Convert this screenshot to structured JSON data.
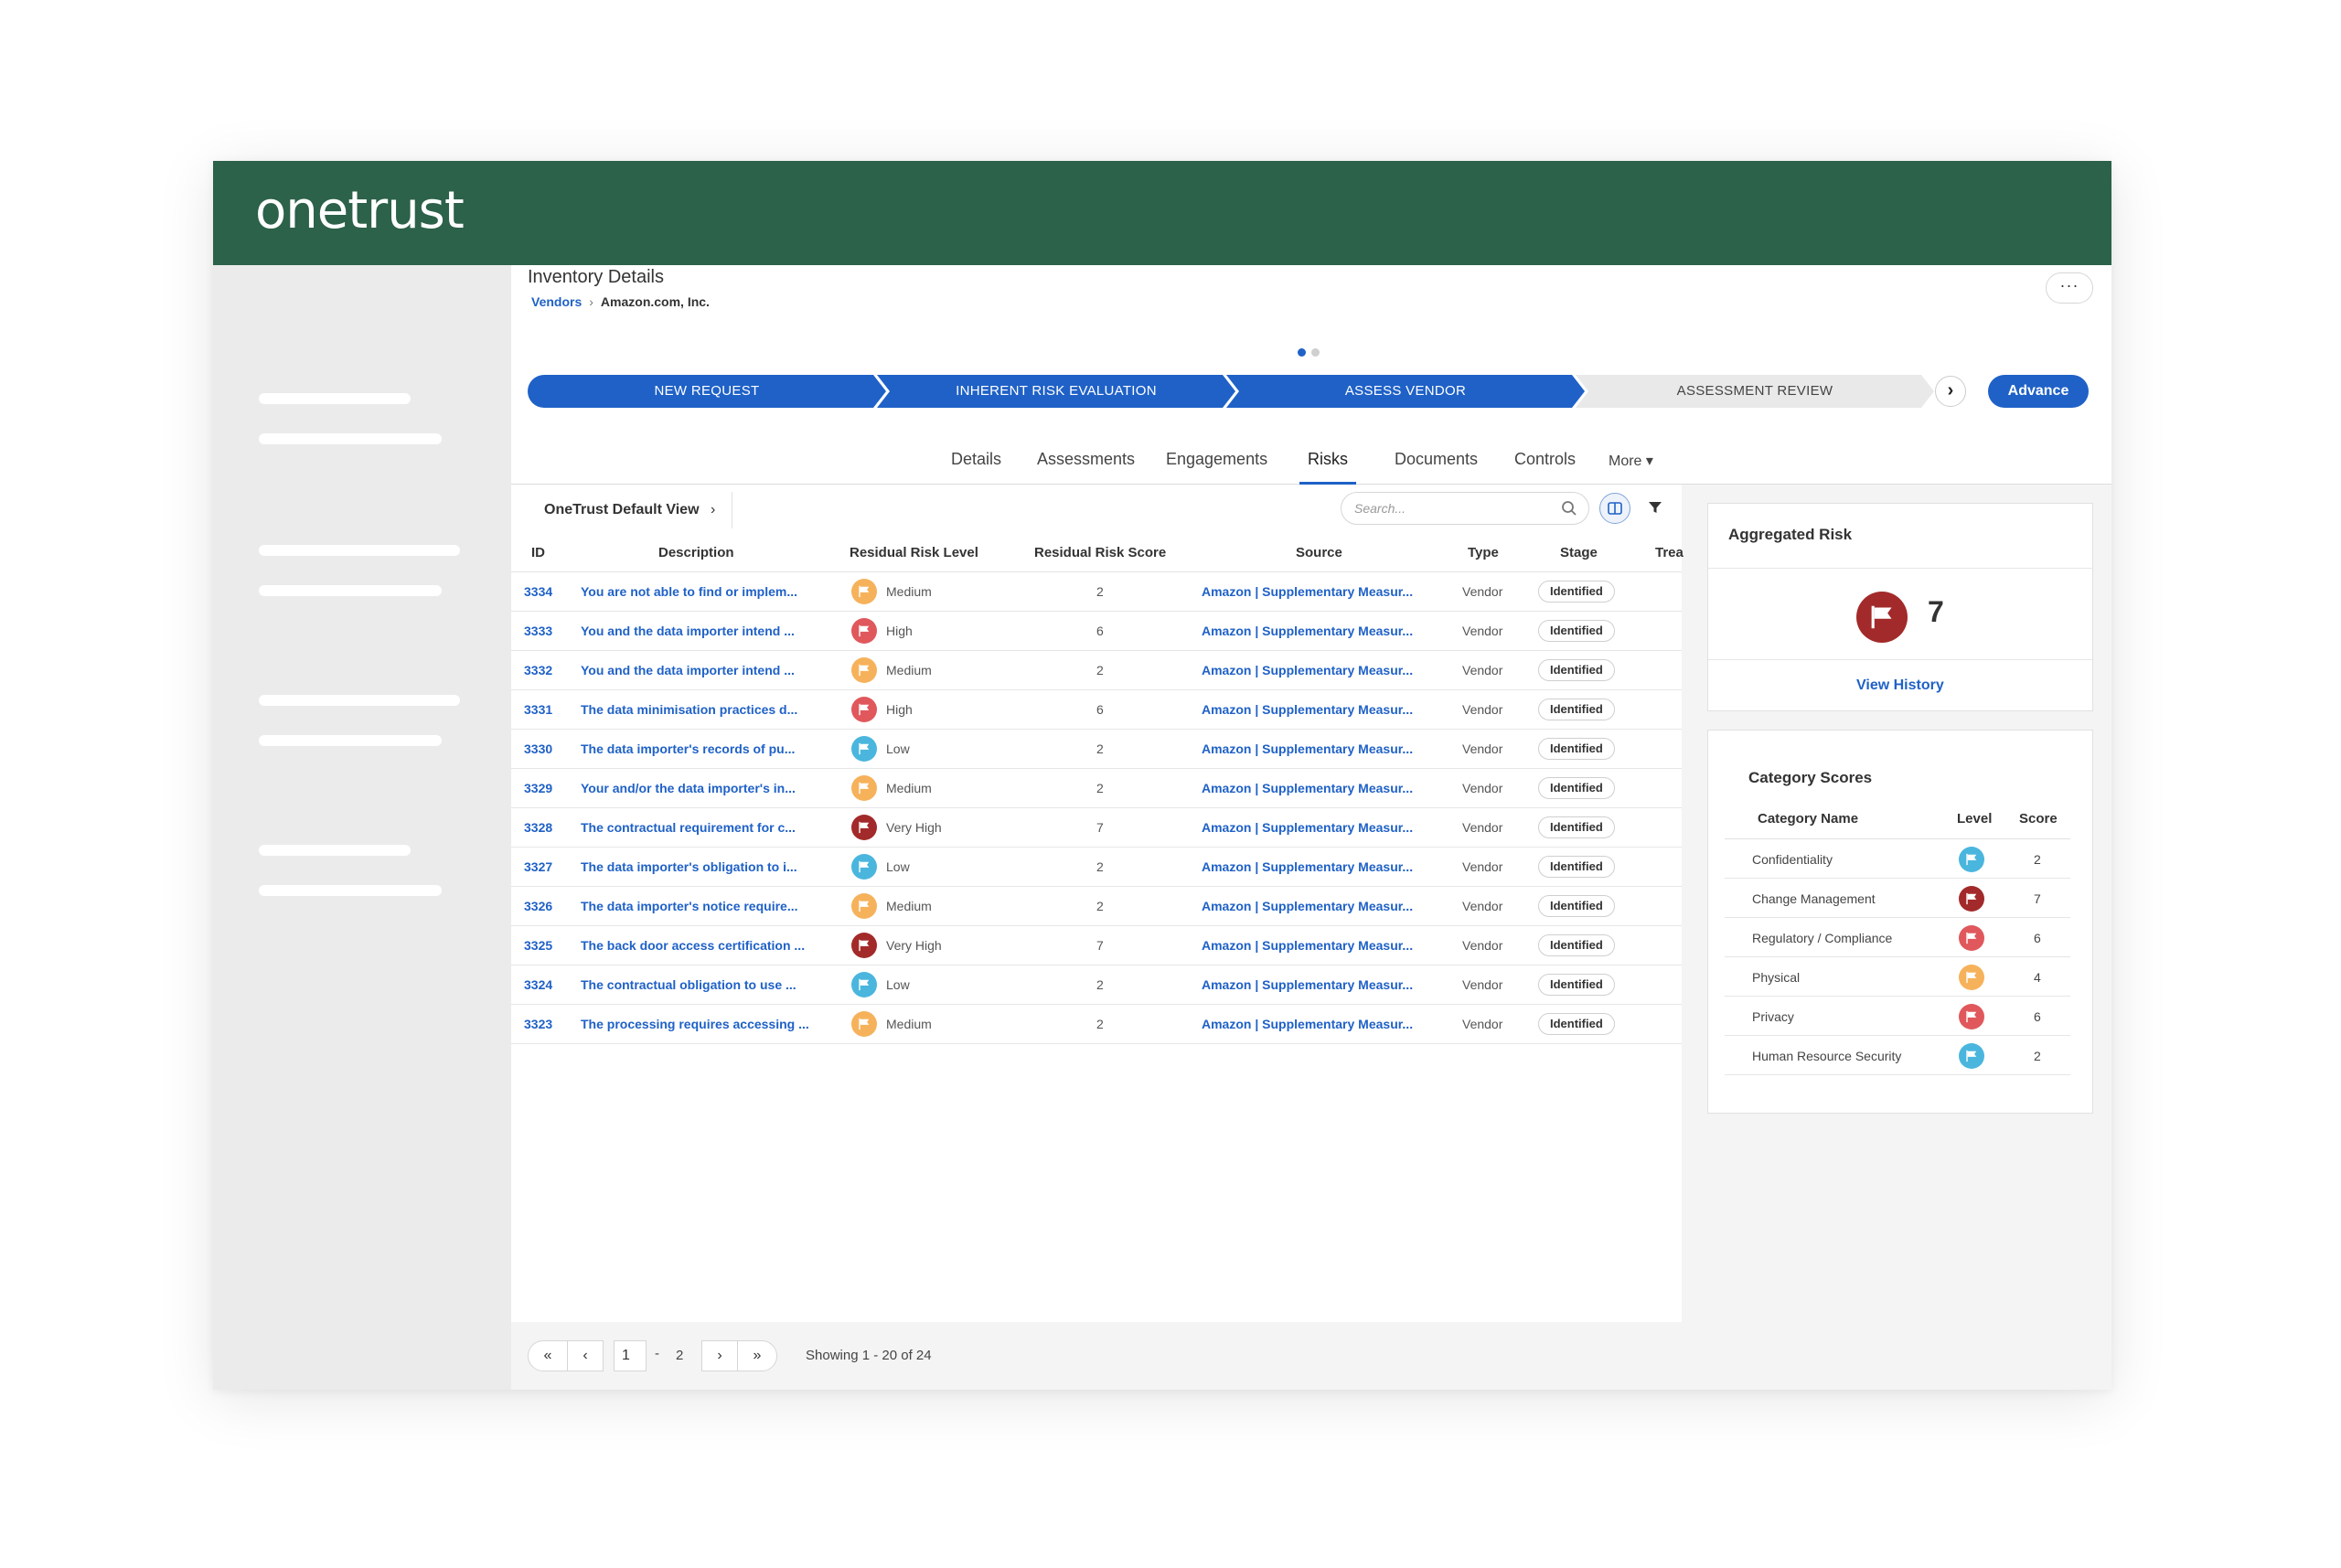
{
  "app": {
    "logo_text": "onetrust"
  },
  "header": {
    "title": "Inventory Details",
    "breadcrumb": {
      "parent": "Vendors",
      "current": "Amazon.com, Inc."
    },
    "more_label": "···"
  },
  "stepper": {
    "steps": [
      {
        "label": "NEW REQUEST",
        "status": "done"
      },
      {
        "label": "INHERENT RISK EVALUATION",
        "status": "done"
      },
      {
        "label": "ASSESS VENDOR",
        "status": "current"
      },
      {
        "label": "ASSESSMENT REVIEW",
        "status": "todo"
      }
    ],
    "next_icon": "chevron-right-icon",
    "advance_label": "Advance"
  },
  "tabs": {
    "items": [
      "Details",
      "Assessments",
      "Engagements",
      "Risks",
      "Documents",
      "Controls",
      "More ▾"
    ],
    "active": "Risks"
  },
  "toolbar": {
    "view_label": "OneTrust Default View",
    "view_chevron": "›",
    "search_placeholder": "Search..."
  },
  "colors": {
    "brand_green": "#2c614a",
    "accent_blue": "#1f61c7",
    "low": "#4ab6de",
    "medium": "#f6b25b",
    "high": "#e0585c",
    "very_high": "#a32a2a"
  },
  "risks_table": {
    "columns": [
      "ID",
      "Description",
      "Residual Risk Level",
      "Residual Risk Score",
      "Source",
      "Type",
      "Stage",
      "Trea"
    ],
    "rows": [
      {
        "id": "3334",
        "desc": "You are not able to find or implem...",
        "level": "Medium",
        "score": "2",
        "source": "Amazon | Supplementary Measur...",
        "type": "Vendor",
        "stage": "Identified"
      },
      {
        "id": "3333",
        "desc": "You and the data importer intend ...",
        "level": "High",
        "score": "6",
        "source": "Amazon | Supplementary Measur...",
        "type": "Vendor",
        "stage": "Identified"
      },
      {
        "id": "3332",
        "desc": "You and the data importer intend ...",
        "level": "Medium",
        "score": "2",
        "source": "Amazon | Supplementary Measur...",
        "type": "Vendor",
        "stage": "Identified"
      },
      {
        "id": "3331",
        "desc": "The data minimisation practices d...",
        "level": "High",
        "score": "6",
        "source": "Amazon | Supplementary Measur...",
        "type": "Vendor",
        "stage": "Identified"
      },
      {
        "id": "3330",
        "desc": "The data importer's records of pu...",
        "level": "Low",
        "score": "2",
        "source": "Amazon | Supplementary Measur...",
        "type": "Vendor",
        "stage": "Identified"
      },
      {
        "id": "3329",
        "desc": "Your and/or the data importer's in...",
        "level": "Medium",
        "score": "2",
        "source": "Amazon | Supplementary Measur...",
        "type": "Vendor",
        "stage": "Identified"
      },
      {
        "id": "3328",
        "desc": "The contractual requirement for c...",
        "level": "Very High",
        "score": "7",
        "source": "Amazon | Supplementary Measur...",
        "type": "Vendor",
        "stage": "Identified"
      },
      {
        "id": "3327",
        "desc": "The data importer's obligation to i...",
        "level": "Low",
        "score": "2",
        "source": "Amazon | Supplementary Measur...",
        "type": "Vendor",
        "stage": "Identified"
      },
      {
        "id": "3326",
        "desc": "The data importer's notice require...",
        "level": "Medium",
        "score": "2",
        "source": "Amazon | Supplementary Measur...",
        "type": "Vendor",
        "stage": "Identified"
      },
      {
        "id": "3325",
        "desc": "The back door access certification ...",
        "level": "Very High",
        "score": "7",
        "source": "Amazon | Supplementary Measur...",
        "type": "Vendor",
        "stage": "Identified"
      },
      {
        "id": "3324",
        "desc": "The contractual obligation to use ...",
        "level": "Low",
        "score": "2",
        "source": "Amazon | Supplementary Measur...",
        "type": "Vendor",
        "stage": "Identified"
      },
      {
        "id": "3323",
        "desc": "The processing requires accessing ...",
        "level": "Medium",
        "score": "2",
        "source": "Amazon | Supplementary Measur...",
        "type": "Vendor",
        "stage": "Identified"
      }
    ]
  },
  "pagination": {
    "first": "«",
    "prev": "‹",
    "page_value": "1",
    "page_sep": "-",
    "total_pages": "2",
    "next": "›",
    "last": "»",
    "showing": "Showing 1 - 20 of 24"
  },
  "aggregated_risk": {
    "title": "Aggregated Risk",
    "score": "7",
    "level": "Very High",
    "view_history": "View History"
  },
  "category_scores": {
    "title": "Category Scores",
    "columns": [
      "Category Name",
      "Level",
      "Score"
    ],
    "rows": [
      {
        "name": "Confidentiality",
        "level": "Low",
        "score": "2"
      },
      {
        "name": "Change Management",
        "level": "Very High",
        "score": "7"
      },
      {
        "name": "Regulatory / Compliance",
        "level": "High",
        "score": "6"
      },
      {
        "name": "Physical",
        "level": "Medium",
        "score": "4"
      },
      {
        "name": "Privacy",
        "level": "High",
        "score": "6"
      },
      {
        "name": "Human Resource Security",
        "level": "Low",
        "score": "2"
      }
    ]
  }
}
